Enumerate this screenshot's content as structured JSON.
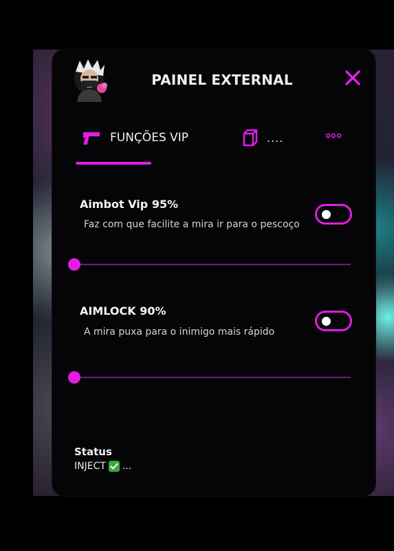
{
  "header": {
    "title": "PAINEL EXTERNAL"
  },
  "tabs": [
    {
      "label": "FUNÇÕES VIP",
      "icon": "gun-icon",
      "active": true
    },
    {
      "label": "....",
      "icon": "cube-icon",
      "active": false
    },
    {
      "label": "",
      "icon": "more-dots-icon",
      "active": false
    }
  ],
  "features": [
    {
      "title": "Aimbot Vip 95%",
      "description": "Faz com que facilite a mira ir para o pescoço",
      "enabled": false,
      "slider_value": 0
    },
    {
      "title": "AIMLOCK 90%",
      "description": "A mira puxa para o inimigo mais rápido",
      "enabled": false,
      "slider_value": 0
    }
  ],
  "status": {
    "label": "Status",
    "value": "INJECT",
    "suffix": "...",
    "check_icon": "check-icon"
  },
  "colors": {
    "accent": "#e21ce4",
    "panel": "#050507",
    "background": "#000000"
  }
}
